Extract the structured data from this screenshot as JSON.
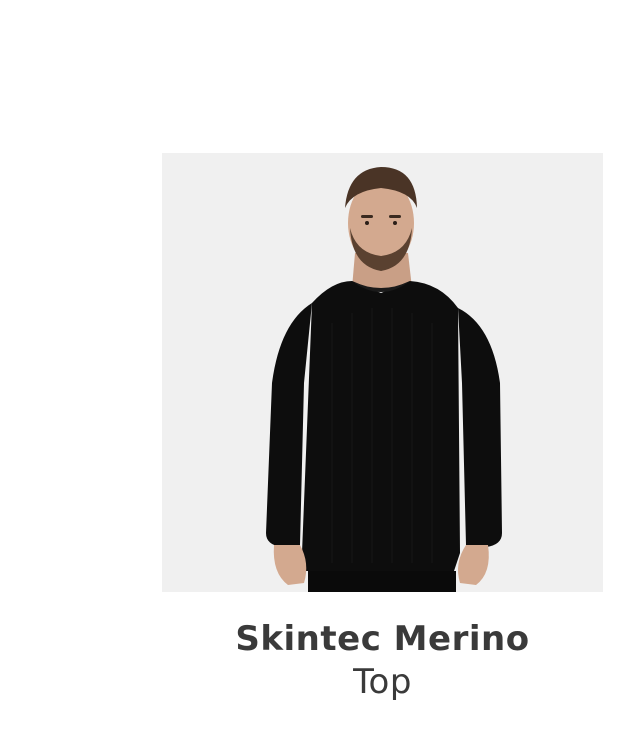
{
  "product": {
    "name_line1": "Skintec Merino",
    "name_line2": "Top",
    "image_icon": "product-photo",
    "colors": {
      "image_background": "#f0f0f0",
      "title_text": "#3a3a3a",
      "garment": "#0d0d0d"
    }
  }
}
